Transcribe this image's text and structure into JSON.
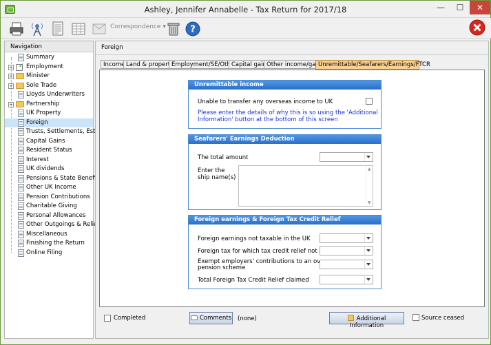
{
  "window": {
    "title": "Ashley, Jennifer Annabelle - Tax Return for 2017/18",
    "minimize": "—",
    "maximize": "☐",
    "close": "✕"
  },
  "toolbar": {
    "correspondence": "Correspondence",
    "help": "?"
  },
  "nav": {
    "heading": "Navigation",
    "items": [
      {
        "label": "Summary",
        "type": "doc",
        "expand": ""
      },
      {
        "label": "Employment",
        "type": "fold-check",
        "expand": "+"
      },
      {
        "label": "Minister",
        "type": "fold",
        "expand": "+"
      },
      {
        "label": "Sole Trade",
        "type": "fold",
        "expand": "+"
      },
      {
        "label": "Lloyds Underwriters",
        "type": "doc",
        "expand": ""
      },
      {
        "label": "Partnership",
        "type": "fold",
        "expand": "+"
      },
      {
        "label": "UK Property",
        "type": "doc",
        "expand": ""
      },
      {
        "label": "Foreign",
        "type": "doc",
        "expand": "",
        "selected": true
      },
      {
        "label": "Trusts, Settlements, Est...",
        "type": "doc",
        "expand": ""
      },
      {
        "label": "Capital Gains",
        "type": "doc",
        "expand": ""
      },
      {
        "label": "Resident Status",
        "type": "doc",
        "expand": ""
      },
      {
        "label": "Interest",
        "type": "doc",
        "expand": ""
      },
      {
        "label": "UK dividends",
        "type": "doc",
        "expand": ""
      },
      {
        "label": "Pensions & State Benefits",
        "type": "doc",
        "expand": ""
      },
      {
        "label": "Other UK Income",
        "type": "doc",
        "expand": ""
      },
      {
        "label": "Pension Contributions",
        "type": "doc",
        "expand": ""
      },
      {
        "label": "Charitable Giving",
        "type": "doc",
        "expand": ""
      },
      {
        "label": "Personal Allowances",
        "type": "doc",
        "expand": ""
      },
      {
        "label": "Other Outgoings & Relie...",
        "type": "doc",
        "expand": ""
      },
      {
        "label": "Miscellaneous",
        "type": "doc",
        "expand": ""
      },
      {
        "label": "Finishing the Return",
        "type": "doc",
        "expand": ""
      },
      {
        "label": "Online Filing",
        "type": "doc",
        "expand": ""
      }
    ]
  },
  "main": {
    "heading": "Foreign",
    "tabs": [
      "Income",
      "Land & property",
      "Employment/SE/Other",
      "Capital gains",
      "Other income/gains",
      "Unremittable/Seafarers/Earnings/FTCR"
    ],
    "active_tab": 5,
    "unremittable": {
      "title": "Unremittable income",
      "unable_label": "Unable to transfer any overseas income to UK",
      "unable_checked": false,
      "note_line1": "Please enter the details of why this is so using the 'Additional",
      "note_line2": "Information' button at the bottom of this screen"
    },
    "seafarers": {
      "title": "Seafarers' Earnings Deduction",
      "total_label": "The total amount",
      "total_value": "",
      "ship_label_line1": "Enter the",
      "ship_label_line2": "ship name(s)",
      "ship_value": ""
    },
    "ftcr": {
      "title": "Foreign earnings & Foreign Tax Credit Relief",
      "not_taxable_label": "Foreign earnings not taxable in the UK",
      "not_taxable_value": "",
      "not_claimed_label": "Foreign tax for which tax credit relief not claimed",
      "not_claimed_value": "",
      "exempt_label_line1": "Exempt employers' contributions to an overseas",
      "exempt_label_line2": "pension scheme",
      "exempt_value": "",
      "total_ftcr_label": "Total Foreign Tax Credit Relief claimed",
      "total_ftcr_value": ""
    }
  },
  "bottom": {
    "completed_label": "Completed",
    "completed_checked": false,
    "comments_label": "Comments",
    "comments_status": "(none)",
    "additional_info_label": "Additional Information",
    "source_ceased_label": "Source ceased",
    "source_ceased_checked": false
  },
  "colors": {
    "tab_active": "#f9d090",
    "section_header": "#2a6fc9",
    "note_text": "#1a33d6",
    "selected_nav": "#cce4f7",
    "close": "#c7453b"
  }
}
